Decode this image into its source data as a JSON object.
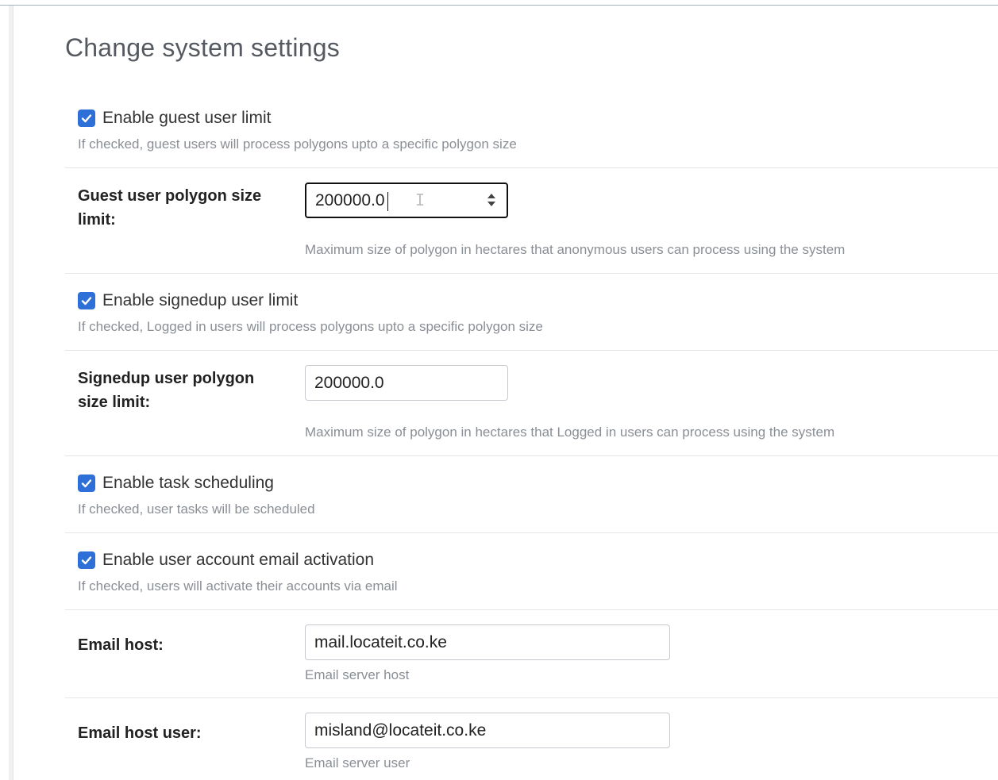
{
  "page": {
    "title": "Change system settings"
  },
  "guest_limit": {
    "checkbox_label": "Enable guest user limit",
    "checkbox_checked": true,
    "checkbox_help": "If checked, guest users will process polygons upto a specific polygon size",
    "field_label": "Guest user polygon size limit:",
    "value": "200000.0",
    "help": "Maximum size of polygon in hectares that anonymous users can process using the system"
  },
  "signedup_limit": {
    "checkbox_label": "Enable signedup user limit",
    "checkbox_checked": true,
    "checkbox_help": "If checked, Logged in users will process polygons upto a specific polygon size",
    "field_label": "Signedup user polygon size limit:",
    "value": "200000.0",
    "help": "Maximum size of polygon in hectares that Logged in users can process using the system"
  },
  "task_scheduling": {
    "checkbox_label": "Enable task scheduling",
    "checkbox_checked": true,
    "checkbox_help": "If checked, user tasks will be scheduled"
  },
  "email_activation": {
    "checkbox_label": "Enable user account email activation",
    "checkbox_checked": true,
    "checkbox_help": "If checked, users will activate their accounts via email"
  },
  "email_host": {
    "field_label": "Email host:",
    "value": "mail.locateit.co.ke",
    "help": "Email server host"
  },
  "email_host_user": {
    "field_label": "Email host user:",
    "value": "misland@locateit.co.ke",
    "help": "Email server user"
  },
  "colors": {
    "checkbox": "#2e6fd8",
    "help_text": "#8a8f95",
    "separator": "#e3e5e8"
  }
}
